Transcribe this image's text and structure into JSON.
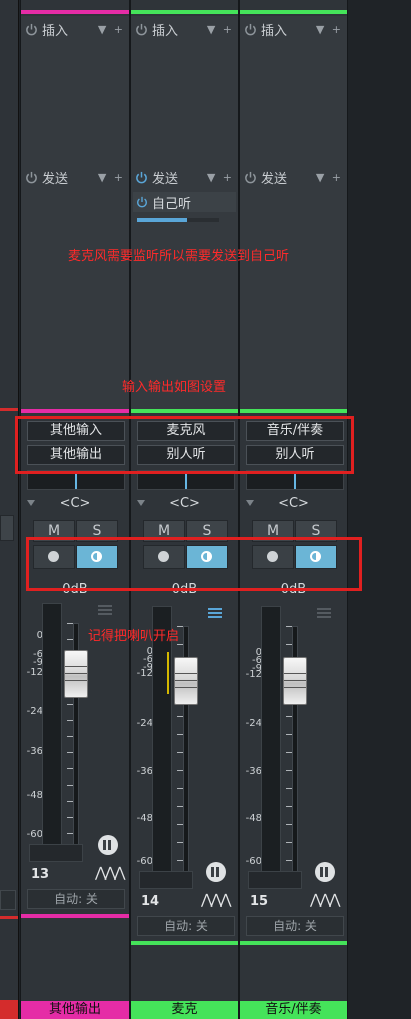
{
  "colors": {
    "accent_blue": "#5aa6d8",
    "pink": "#e52ca6",
    "green": "#45e35a",
    "annotation_red": "#ff2a2a"
  },
  "channels": [
    {
      "insert_label": "插入",
      "send_label": "发送",
      "send_item": "",
      "input": "其他输入",
      "output": "其他输出",
      "pan": "<C>",
      "mute": "M",
      "solo": "S",
      "db": "0dB",
      "number": "13",
      "automation": "自动: 关",
      "name": "其他输出",
      "scale": [
        "0",
        "-6",
        "-9",
        "-12",
        "-24",
        "-36",
        "-48",
        "-60"
      ]
    },
    {
      "insert_label": "插入",
      "send_label": "发送",
      "send_item": "自己听",
      "input": "麦克风",
      "output": "别人听",
      "pan": "<C>",
      "mute": "M",
      "solo": "S",
      "db": "0dB",
      "number": "14",
      "automation": "自动: 关",
      "name": "麦克",
      "scale": [
        "0",
        "-6",
        "-9",
        "-12",
        "-24",
        "-36",
        "-48",
        "-60"
      ]
    },
    {
      "insert_label": "插入",
      "send_label": "发送",
      "send_item": "",
      "input": "音乐/伴奏",
      "output": "别人听",
      "pan": "<C>",
      "mute": "M",
      "solo": "S",
      "db": "0dB",
      "number": "15",
      "automation": "自动: 关",
      "name": "音乐/伴奏",
      "scale": [
        "0",
        "-6",
        "-9",
        "-12",
        "-24",
        "-36",
        "-48",
        "-60"
      ]
    }
  ],
  "annotations": {
    "send_note": "麦克风需要监听所以需要发送到自己听",
    "io_note": "输入输出如图设置",
    "monitor_note": "记得把喇叭开启"
  },
  "icons": [
    "power-icon",
    "dropdown-icon",
    "plus-icon",
    "record-arm-icon",
    "monitor-icon",
    "group-icon",
    "waveform-icon"
  ]
}
